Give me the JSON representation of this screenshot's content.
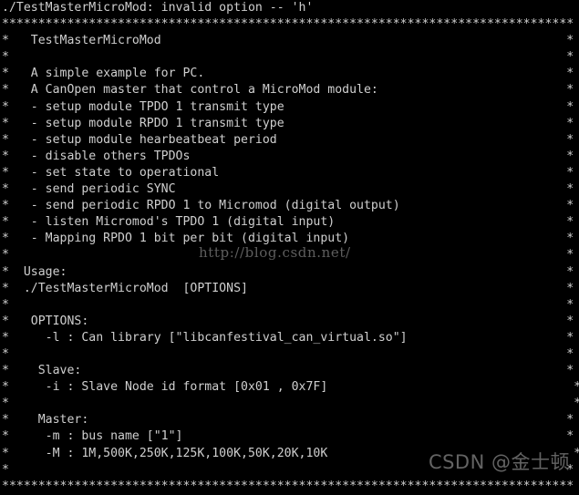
{
  "terminal": {
    "title": "Terminal",
    "background_color": "#000000",
    "text_color": "#cfcfcf",
    "columns": 79,
    "error_line": "./TestMasterMicroMod: invalid option -- 'h'",
    "border_top": "*******************************************************************************",
    "border_bottom": "*******************************************************************************",
    "lines": [
      "*   TestMasterMicroMod                                                        *",
      "*                                                                             *",
      "*   A simple example for PC.                                                  *",
      "*   A CanOpen master that control a MicroMod module:                          *",
      "*   - setup module TPDO 1 transmit type                                       *",
      "*   - setup module RPDO 1 transmit type                                       *",
      "*   - setup module hearbeatbeat period                                        *",
      "*   - disable others TPDOs                                                    *",
      "*   - set state to operational                                                *",
      "*   - send periodic SYNC                                                      *",
      "*   - send periodic RPDO 1 to Micromod (digital output)                       *",
      "*   - listen Micromod's TPDO 1 (digital input)                                *",
      "*   - Mapping RPDO 1 bit per bit (digital input)                              *",
      "*                                                                             *",
      "*  Usage:                                                                     *",
      "*  ./TestMasterMicroMod  [OPTIONS]                                            *",
      "*                                                                             *",
      "*   OPTIONS:                                                                  *",
      "*     -l : Can library [\"libcanfestival_can_virtual.so\"]                      *",
      "*                                                                             *",
      "*    Slave:                                                                   *",
      "*     -i : Slave Node id format [0x01 , 0x7F]                                  *",
      "*                                                                              *",
      "*    Master:                                                                  *",
      "*     -m : bus name [\"1\"]                                                     *",
      "*     -M : 1M,500K,250K,125K,100K,50K,20K,10K                                  *",
      "*                                                                             *"
    ]
  },
  "watermarks": {
    "url": "http://blog.csdn.net/",
    "url_color": "#5e5e5e",
    "author": "CSDN @金士顿",
    "author_color": "#8a8a8a"
  }
}
